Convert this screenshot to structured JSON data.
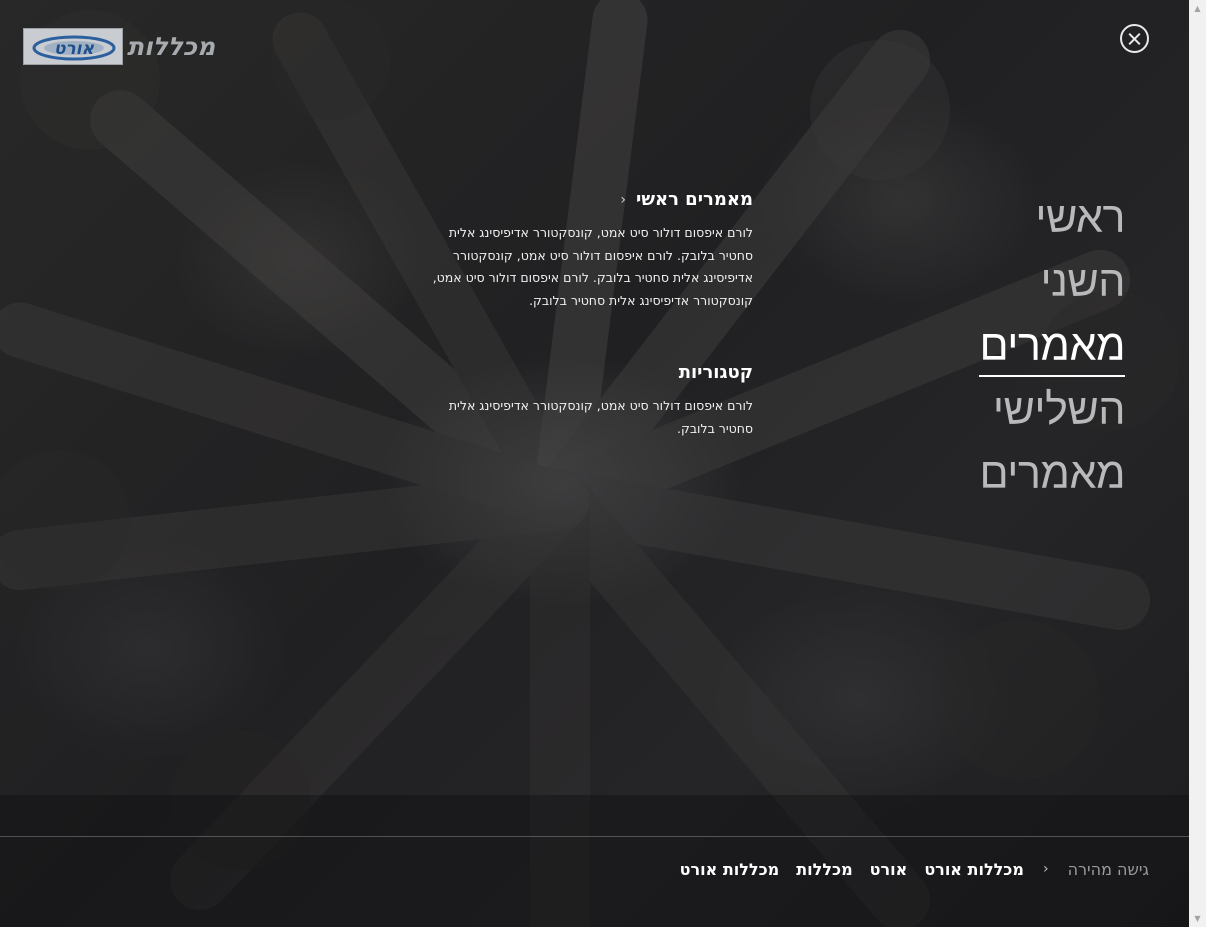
{
  "logo": {
    "brand_text": "מכללות",
    "badge_text": "אורט"
  },
  "close": {
    "label": "×"
  },
  "menu": {
    "items": [
      {
        "label": "ראשי",
        "active": false
      },
      {
        "label": "השני",
        "active": false
      },
      {
        "label": "מאמרים",
        "active": true
      },
      {
        "label": "השלישי",
        "active": false
      },
      {
        "label": "מאמרים",
        "active": false
      }
    ]
  },
  "panels": [
    {
      "title": "מאמרים ראשי",
      "chevron": "‹",
      "text": "לורם איפסום דולור סיט אמט, קונסקטורר אדיפיסינג אלית סחטיר בלובק. לורם איפסום דולור סיט אמט, קונסקטורר אדיפיסינג אלית סחטיר בלובק. לורם איפסום דולור סיט אמט, קונסקטורר אדיפיסינג אלית סחטיר בלובק."
    },
    {
      "title": "קטגוריות",
      "text": "לורם איפסום דולור סיט אמט, קונסקטורר אדיפיסינג אלית סחטיר בלובק."
    }
  ],
  "quick_access": {
    "title": "גישה מהירה",
    "chevron": "‹",
    "links": [
      "מכללות אורט",
      "אורט",
      "מכללות",
      "מכללות אורט"
    ]
  },
  "scrollbar": {
    "up": "▲",
    "down": "▼"
  }
}
